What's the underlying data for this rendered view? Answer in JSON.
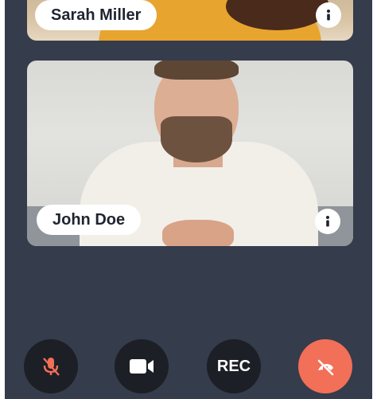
{
  "participants": [
    {
      "name": "Sarah Miller",
      "info_icon": "info-icon"
    },
    {
      "name": "John Doe",
      "info_icon": "info-icon"
    }
  ],
  "controls": {
    "mute_icon": "mic-off-icon",
    "video_icon": "video-camera-icon",
    "record_label": "REC",
    "end_icon": "phone-hangup-icon"
  },
  "colors": {
    "background": "#353c4b",
    "control_button": "#1d1f26",
    "mute_icon_color": "#f26f58",
    "end_call": "#f26f58",
    "pill": "#ffffff"
  }
}
